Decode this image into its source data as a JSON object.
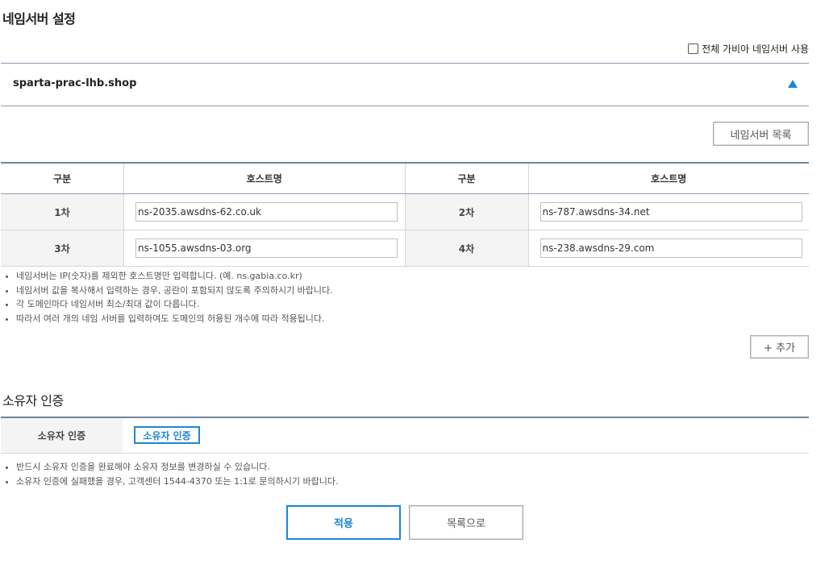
{
  "page": {
    "title": "네임서버 설정"
  },
  "use_all_gabia": {
    "label": "전체 가비아 네임서버 사용",
    "checked": false
  },
  "domain": {
    "name": "sparta-prac-lhb.shop"
  },
  "ns_list_button": "네임서버 목록",
  "ns_table": {
    "headers": [
      "구분",
      "호스트명",
      "구분",
      "호스트명"
    ],
    "rows": [
      {
        "label_a": "1차",
        "host_a": "ns-2035.awsdns-62.co.uk",
        "label_b": "2차",
        "host_b": "ns-787.awsdns-34.net"
      },
      {
        "label_a": "3차",
        "host_a": "ns-1055.awsdns-03.org",
        "label_b": "4차",
        "host_b": "ns-238.awsdns-29.com"
      }
    ]
  },
  "ns_notes": [
    "네임서버는 IP(숫자)를 제외한 호스트명만 입력합니다. (예. ns.gabia.co.kr)",
    "네임서버 값을 복사해서 입력하는 경우, 공란이 포함되지 않도록 주의하시기 바랍니다.",
    "각 도메인마다 네임서버 최소/최대 값이 다릅니다.",
    "따라서 여러 개의 네임 서버를 입력하여도 도메인의 허용된 개수에 따라 적용됩니다."
  ],
  "add_button": "+ 추가",
  "owner": {
    "title": "소유자 인증",
    "row_label": "소유자 인증",
    "button": "소유자 인증",
    "notes": [
      "반드시 소유자 인증을 완료해야 소유자 정보를 변경하실 수 있습니다.",
      "소유자 인증에 실패했을 경우, 고객센터 1544-4370 또는 1:1로 문의하시기 바랍니다."
    ]
  },
  "actions": {
    "apply": "적용",
    "list": "목록으로"
  },
  "colors": {
    "accent": "#1e86d0",
    "rule": "#70849a",
    "label_bg": "#f4f4f4"
  }
}
